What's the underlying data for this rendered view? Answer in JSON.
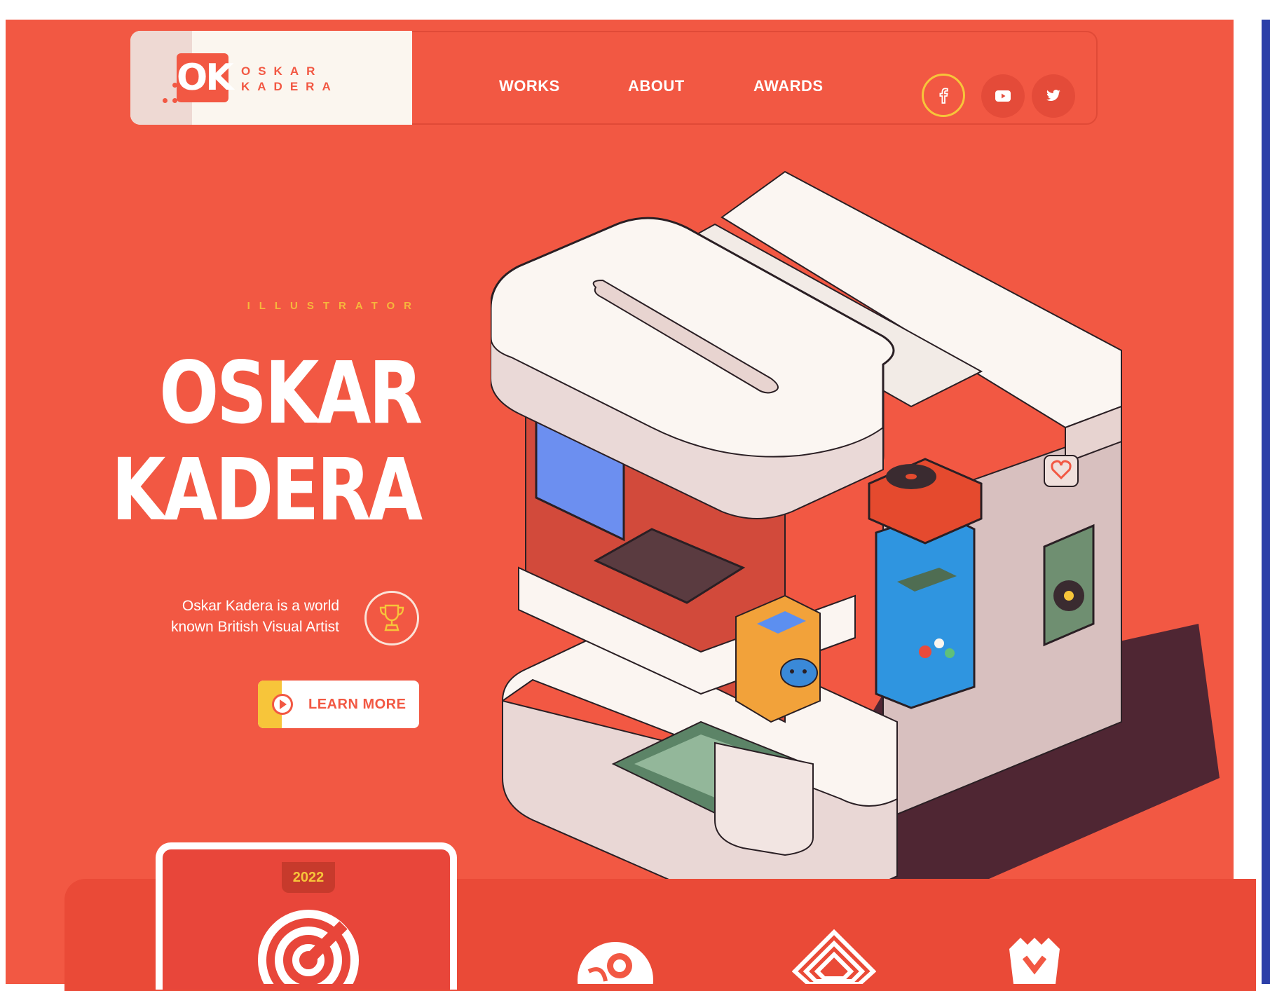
{
  "brand": {
    "mark": "OK",
    "line1": "OSKAR",
    "line2": "KADERA"
  },
  "nav": [
    {
      "label": "WORKS"
    },
    {
      "label": "ABOUT"
    },
    {
      "label": "AWARDS"
    }
  ],
  "social": [
    "facebook-icon",
    "youtube-icon",
    "twitter-icon"
  ],
  "hero": {
    "eyebrow": "ILLUSTRATOR",
    "title_line1": "OSKAR",
    "title_line2": "KADERA",
    "description": "Oskar Kadera is a world known British Visual Artist",
    "cta": "LEARN MORE"
  },
  "awards": {
    "year": "2022"
  },
  "colors": {
    "background": "#f25843",
    "accent_yellow": "#f7c53a",
    "cream": "#fbf6ef",
    "scrollbar": "#2c3fa8"
  },
  "illustration_text": {
    "ok_letters": "OK"
  }
}
